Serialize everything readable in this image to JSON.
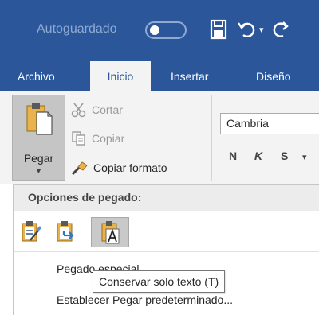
{
  "colors": {
    "brand": "#2b579a",
    "ribbon": "#f3f3f3",
    "pressed": "#c5c5c5",
    "disabled": "#9a9a9a"
  },
  "titlebar": {
    "autosave_label": "Autoguardado",
    "icons": [
      "autosave-toggle",
      "save-icon",
      "undo-icon",
      "redo-icon"
    ]
  },
  "tabs": [
    {
      "label": "Archivo"
    },
    {
      "label": "Inicio",
      "selected": true
    },
    {
      "label": "Insertar"
    },
    {
      "label": "Diseño"
    }
  ],
  "clipboard": {
    "paste_label": "Pegar",
    "cut_label": "Cortar",
    "copy_label": "Copiar",
    "format_painter_label": "Copiar formato"
  },
  "font": {
    "family_value": "Cambria",
    "bold_label": "N",
    "italic_label": "K",
    "underline_label": "S"
  },
  "paste_menu": {
    "header": "Opciones de pegado:",
    "options": [
      "keep-source-format-icon",
      "merge-format-icon",
      "keep-text-only-icon"
    ],
    "special_label": "Pegado especial...",
    "default_label": "Establecer Pegar predeterminado..."
  },
  "tooltip": {
    "text": "Conservar solo texto (T)"
  }
}
